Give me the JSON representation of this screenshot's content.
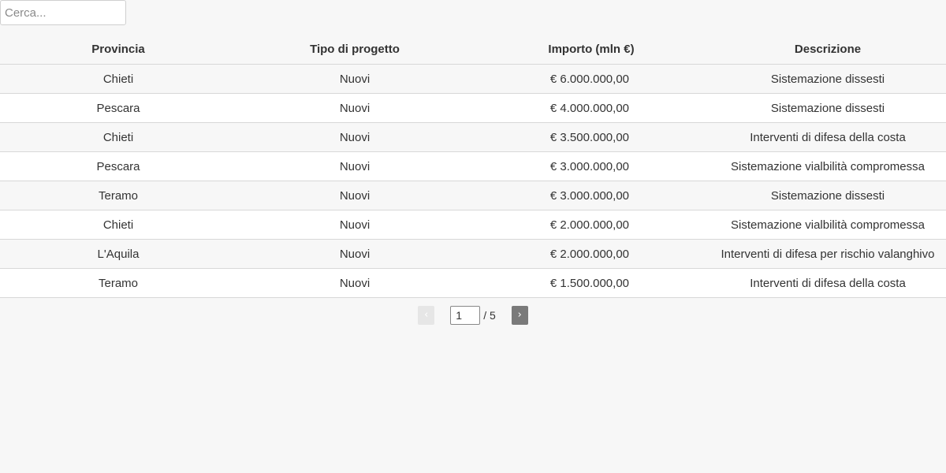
{
  "search": {
    "placeholder": "Cerca...",
    "value": ""
  },
  "table": {
    "headers": {
      "provincia": "Provincia",
      "tipo": "Tipo di progetto",
      "importo": "Importo (mln €)",
      "descrizione": "Descrizione"
    },
    "rows": [
      {
        "provincia": "Chieti",
        "tipo": "Nuovi",
        "importo": "€ 6.000.000,00",
        "descrizione": "Sistemazione dissesti"
      },
      {
        "provincia": "Pescara",
        "tipo": "Nuovi",
        "importo": "€ 4.000.000,00",
        "descrizione": "Sistemazione dissesti"
      },
      {
        "provincia": "Chieti",
        "tipo": "Nuovi",
        "importo": "€ 3.500.000,00",
        "descrizione": "Interventi di difesa della costa"
      },
      {
        "provincia": "Pescara",
        "tipo": "Nuovi",
        "importo": "€ 3.000.000,00",
        "descrizione": "Sistemazione vialbilità compromessa"
      },
      {
        "provincia": "Teramo",
        "tipo": "Nuovi",
        "importo": "€ 3.000.000,00",
        "descrizione": "Sistemazione dissesti"
      },
      {
        "provincia": "Chieti",
        "tipo": "Nuovi",
        "importo": "€ 2.000.000,00",
        "descrizione": "Sistemazione vialbilità compromessa"
      },
      {
        "provincia": "L'Aquila",
        "tipo": "Nuovi",
        "importo": "€ 2.000.000,00",
        "descrizione": "Interventi di difesa per rischio valanghivo"
      },
      {
        "provincia": "Teramo",
        "tipo": "Nuovi",
        "importo": "€ 1.500.000,00",
        "descrizione": "Interventi di difesa della costa"
      }
    ]
  },
  "pagination": {
    "prev_label": "‹",
    "next_label": "›",
    "current_page": "1",
    "total_label": "/ 5",
    "prev_icon": "chevron-left-icon",
    "next_icon": "chevron-right-icon"
  }
}
